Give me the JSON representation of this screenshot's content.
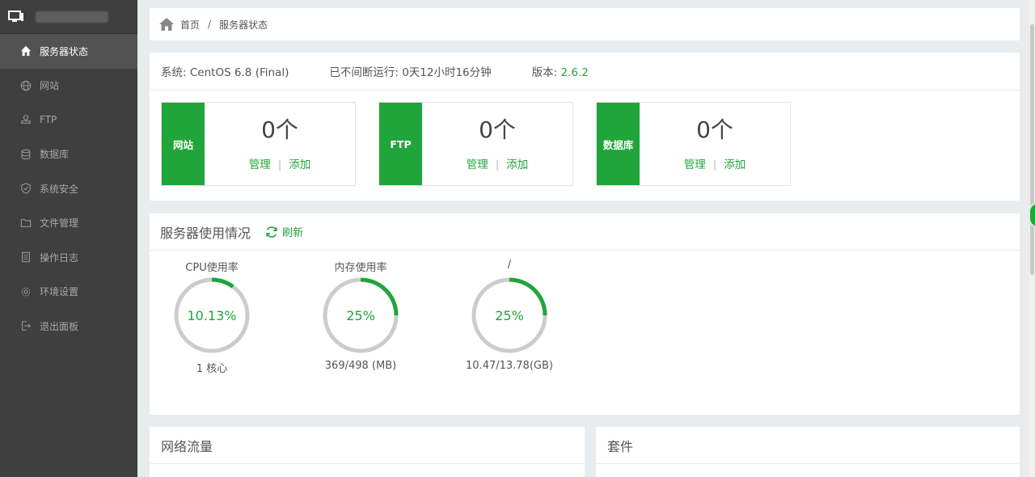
{
  "sidebar": {
    "items": [
      {
        "label": "服务器状态",
        "icon": "home-icon",
        "active": true
      },
      {
        "label": "网站",
        "icon": "globe-icon",
        "active": false
      },
      {
        "label": "FTP",
        "icon": "ftp-icon",
        "active": false
      },
      {
        "label": "数据库",
        "icon": "database-icon",
        "active": false
      },
      {
        "label": "系统安全",
        "icon": "shield-icon",
        "active": false
      },
      {
        "label": "文件管理",
        "icon": "folder-icon",
        "active": false
      },
      {
        "label": "操作日志",
        "icon": "log-icon",
        "active": false
      },
      {
        "label": "环境设置",
        "icon": "gear-icon",
        "active": false
      },
      {
        "label": "退出面板",
        "icon": "logout-icon",
        "active": false
      }
    ]
  },
  "breadcrumb": {
    "home": "首页",
    "separator": "/",
    "current": "服务器状态"
  },
  "system": {
    "os_label": "系统:",
    "os_value": "CentOS 6.8 (Final)",
    "uptime_label": "已不间断运行:",
    "uptime_value": "0天12小时16分钟",
    "version_label": "版本:",
    "version_value": "2.6.2"
  },
  "stats": [
    {
      "label": "网站",
      "count": "0个",
      "manage": "管理",
      "add": "添加"
    },
    {
      "label": "FTP",
      "count": "0个",
      "manage": "管理",
      "add": "添加"
    },
    {
      "label": "数据库",
      "count": "0个",
      "manage": "管理",
      "add": "添加"
    }
  ],
  "usage": {
    "title": "服务器使用情况",
    "refresh": "刷新",
    "gauges": [
      {
        "title": "CPU使用率",
        "value_text": "10.13%",
        "fraction": 0.1013,
        "sub": "1 核心"
      },
      {
        "title": "内存使用率",
        "value_text": "25%",
        "fraction": 0.25,
        "sub": "369/498 (MB)"
      },
      {
        "title": "/",
        "value_text": "25%",
        "fraction": 0.25,
        "sub": "10.47/13.78(GB)"
      }
    ]
  },
  "network": {
    "title": "网络流量"
  },
  "packages": {
    "title": "套件"
  },
  "colors": {
    "accent": "#20a53a",
    "track": "#cccccc",
    "sidebar": "#3f3f3f"
  }
}
